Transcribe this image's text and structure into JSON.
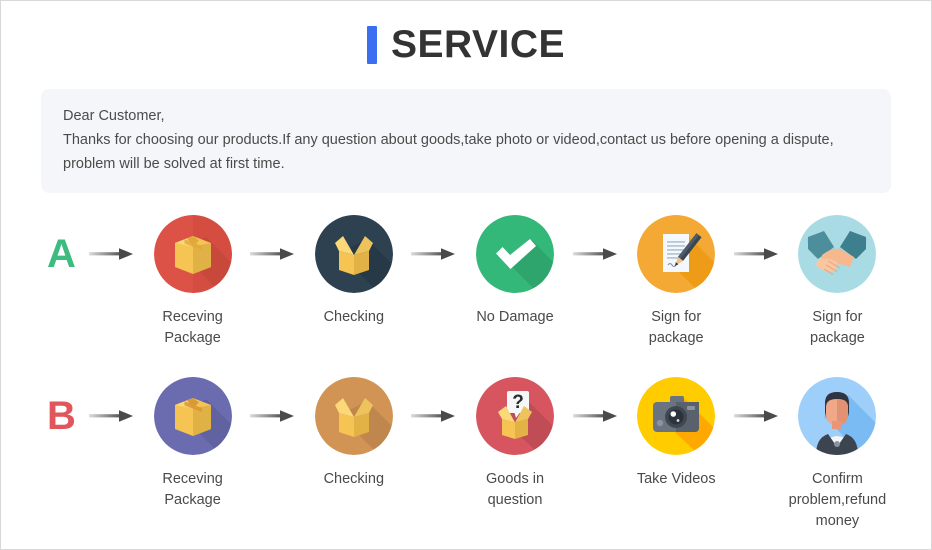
{
  "header": {
    "accent_bar_color": "#3b6ef0",
    "title": "SERVICE"
  },
  "notice": {
    "line1": "Dear Customer,",
    "line2": "Thanks for choosing our products.If any question about goods,take photo or videod,contact us before opening a dispute,",
    "line3": "problem will be solved at first time."
  },
  "rows": [
    {
      "letter": "A",
      "letter_color": "#3cbc7e",
      "steps": [
        {
          "icon": "package-box-icon",
          "circle_color": "#dd5246",
          "label": "Receving Package"
        },
        {
          "icon": "open-box-icon",
          "circle_color": "#2d4150",
          "label": "Checking"
        },
        {
          "icon": "check-mark-icon",
          "circle_color": "#34b87a",
          "label": "No Damage"
        },
        {
          "icon": "document-pen-icon",
          "circle_color": "#f5a935",
          "label": "Sign for package"
        },
        {
          "icon": "handshake-icon",
          "circle_color": "#a8dbe4",
          "label": "Sign for package"
        }
      ]
    },
    {
      "letter": "B",
      "letter_color": "#e0565a",
      "steps": [
        {
          "icon": "package-box-icon",
          "circle_color": "#6b6cb0",
          "label": "Receving Package"
        },
        {
          "icon": "open-box-icon",
          "circle_color": "#d29455",
          "label": "Checking"
        },
        {
          "icon": "question-box-icon",
          "circle_color": "#d6555f",
          "label": "Goods in question"
        },
        {
          "icon": "camera-icon",
          "circle_color": "#ffcc00",
          "label": "Take Videos"
        },
        {
          "icon": "support-person-icon",
          "circle_color": "#8ec7f5",
          "label": "Confirm problem,refund money"
        }
      ]
    }
  ],
  "arrow": {
    "name": "right-arrow-icon",
    "color_start": "#d5d5d5",
    "color_end": "#4a4a4a"
  }
}
